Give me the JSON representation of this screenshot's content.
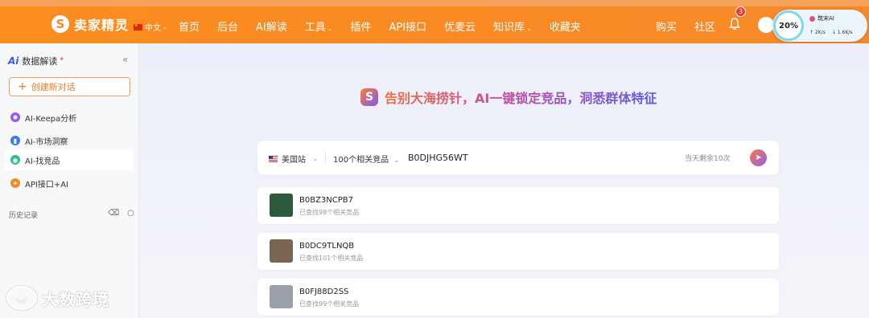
{
  "header": {
    "logo_text": "卖家精灵",
    "language": "中文",
    "nav": [
      {
        "label": "首页",
        "has_caret": false
      },
      {
        "label": "后台",
        "has_caret": false
      },
      {
        "label": "AI解读",
        "has_caret": false
      },
      {
        "label": "工具",
        "has_caret": true
      },
      {
        "label": "插件",
        "has_caret": false
      },
      {
        "label": "API接口",
        "has_caret": false
      },
      {
        "label": "优麦云",
        "has_caret": false
      },
      {
        "label": "知识库",
        "has_caret": true
      },
      {
        "label": "收藏夹",
        "has_caret": false
      }
    ],
    "right_nav": [
      "购买",
      "社区"
    ],
    "notification_count": "3"
  },
  "widget": {
    "percent": "20%",
    "title": "筑宋AI",
    "upload": "↑ 2K/s",
    "download": "↓ 1.6K/s"
  },
  "sidebar": {
    "title": "数据解读",
    "new_chat_label": "创建新对话",
    "items": [
      {
        "label": "AI-Keepa分析",
        "icon": "keepa-icon",
        "color": "#8e5cf0",
        "active": false
      },
      {
        "label": "AI-市场洞察",
        "icon": "bar-chart-icon",
        "color": "#3a7bf0",
        "active": false
      },
      {
        "label": "AI-找竞品",
        "icon": "search-competitor-icon",
        "color": "#2fbf8a",
        "active": true
      },
      {
        "label": "API接口+AI",
        "icon": "api-icon",
        "color": "#f08a2a",
        "active": false
      }
    ],
    "history_label": "历史记录"
  },
  "main": {
    "hero_text": "告别大海捞针，AI一键锁定竞品，洞悉群体特征",
    "search": {
      "site": "美国站",
      "count_option": "100个相关竞品",
      "query": "B0DJHG56WT",
      "remaining": "当天剩余10次"
    },
    "results": [
      {
        "asin": "B0BZ3NCPB7",
        "sub": "已查找98个相关竞品",
        "thumb_color": "#2e5a3c"
      },
      {
        "asin": "B0DC9TLNQB",
        "sub": "已查找101个相关竞品",
        "thumb_color": "#7a6552"
      },
      {
        "asin": "B0FJ88D2SS",
        "sub": "已查找99个相关竞品",
        "thumb_color": "#9aa0a8"
      }
    ]
  },
  "watermark": "大数跨境",
  "colors": {
    "brand": "#f7892a",
    "accent": "#7b5cf0"
  }
}
